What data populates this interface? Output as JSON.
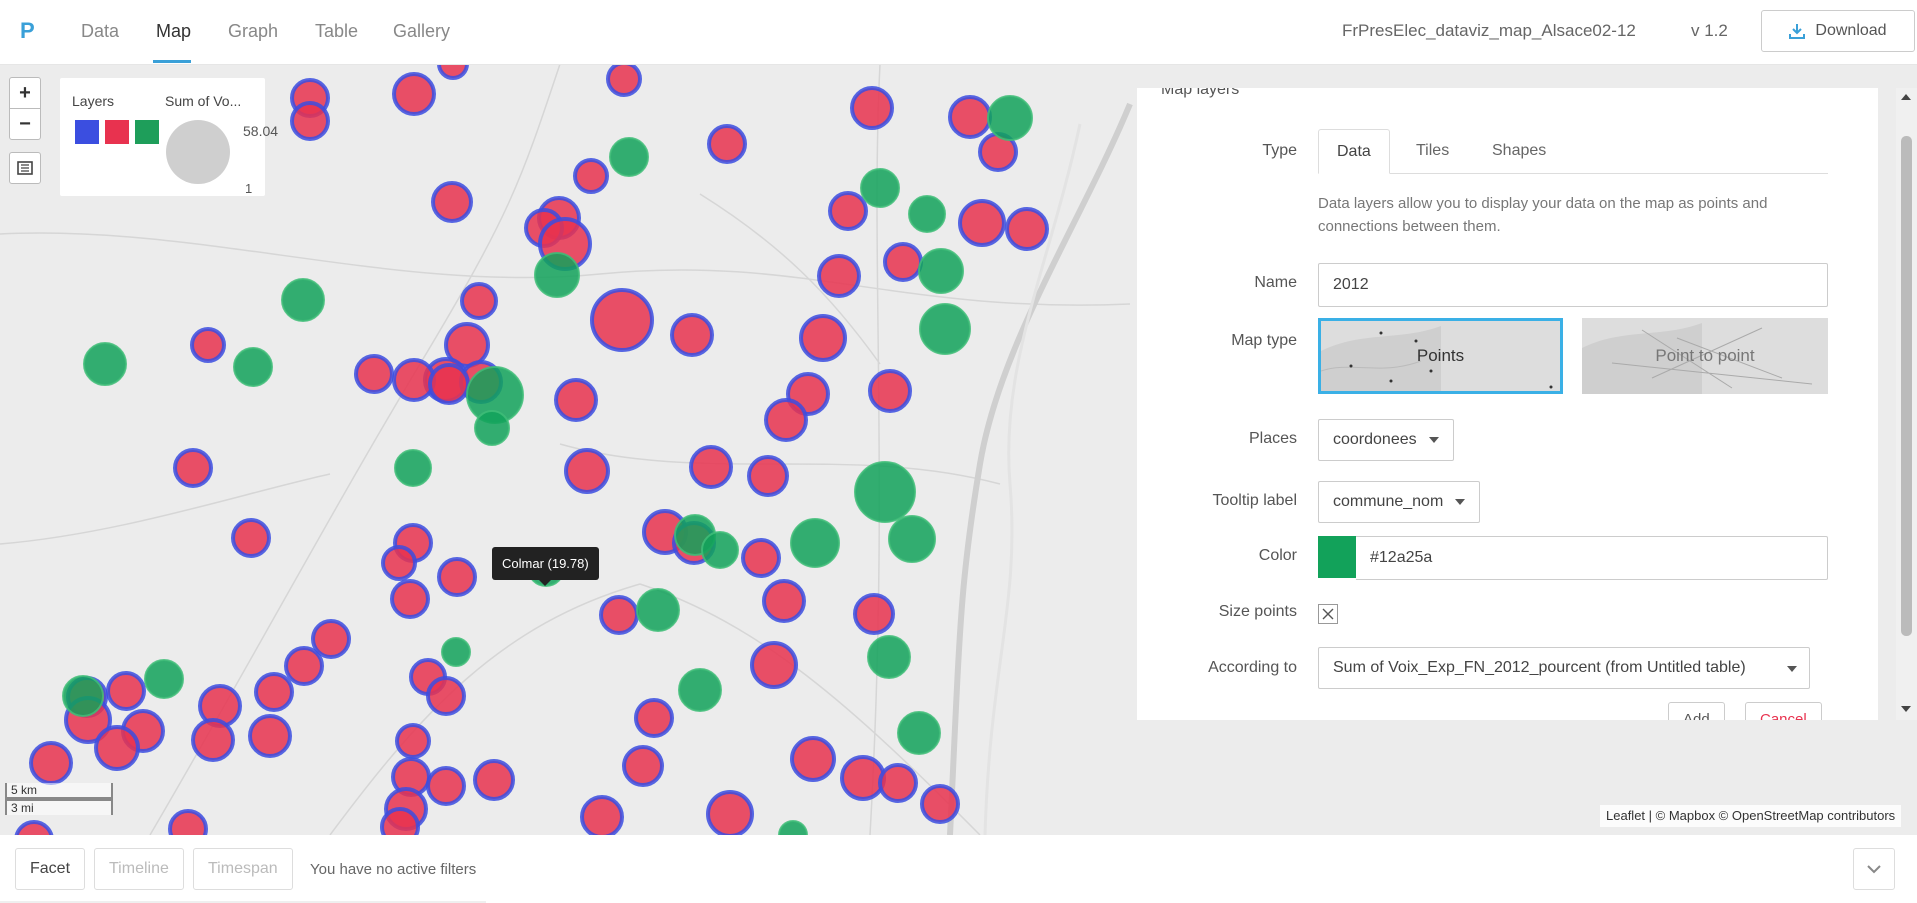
{
  "app": {
    "logo": "P",
    "tabs": [
      {
        "label": "Data"
      },
      {
        "label": "Map"
      },
      {
        "label": "Graph"
      },
      {
        "label": "Table"
      },
      {
        "label": "Gallery"
      }
    ],
    "active_tab": "Map",
    "project_name": "FrPresElec_dataviz_map_Alsace02-12",
    "version": "v 1.2",
    "download_label": "Download"
  },
  "map": {
    "zoom_in": "+",
    "zoom_out": "−",
    "legend": {
      "layers_title": "Layers",
      "size_title": "Sum of Vo...",
      "max_value": "58.04",
      "min_value": "1",
      "layer_colors": [
        "#3b4ee0",
        "#e8324f",
        "#1e9e5a"
      ]
    },
    "tooltip": "Colmar (19.78)",
    "scale_km": "5 km",
    "scale_mi": "3 mi",
    "attribution": "Leaflet | © Mapbox © OpenStreetMap contributors"
  },
  "panel": {
    "title": "Map layers",
    "type_label": "Type",
    "type_tabs": [
      {
        "label": "Data"
      },
      {
        "label": "Tiles"
      },
      {
        "label": "Shapes"
      }
    ],
    "active_type": "Data",
    "description": "Data layers allow you to display your data on the map as points and connections between them.",
    "name_label": "Name",
    "name_value": "2012",
    "map_type_label": "Map type",
    "map_types": [
      {
        "label": "Points"
      },
      {
        "label": "Point to point"
      }
    ],
    "selected_map_type": "Points",
    "places_label": "Places",
    "places_value": "coordonees",
    "tooltip_label": "Tooltip label",
    "tooltip_value": "commune_nom",
    "color_label": "Color",
    "color_value": "#12a25a",
    "size_points_label": "Size points",
    "size_points_checked": true,
    "according_label": "According to",
    "according_value": "Sum of Voix_Exp_FN_2012_pourcent (from Untitled table)",
    "add_label": "Add",
    "cancel_label": "Cancel"
  },
  "filters": {
    "facet_label": "Facet",
    "timeline_label": "Timeline",
    "timespan_label": "Timespan",
    "status": "You have no active filters"
  },
  "colors": {
    "accent": "#3aa0d8",
    "layer_2002": "#3b4ee0",
    "layer_2007": "#e8324f",
    "layer_2012": "#12a25a",
    "cancel_text": "#e8324f"
  }
}
